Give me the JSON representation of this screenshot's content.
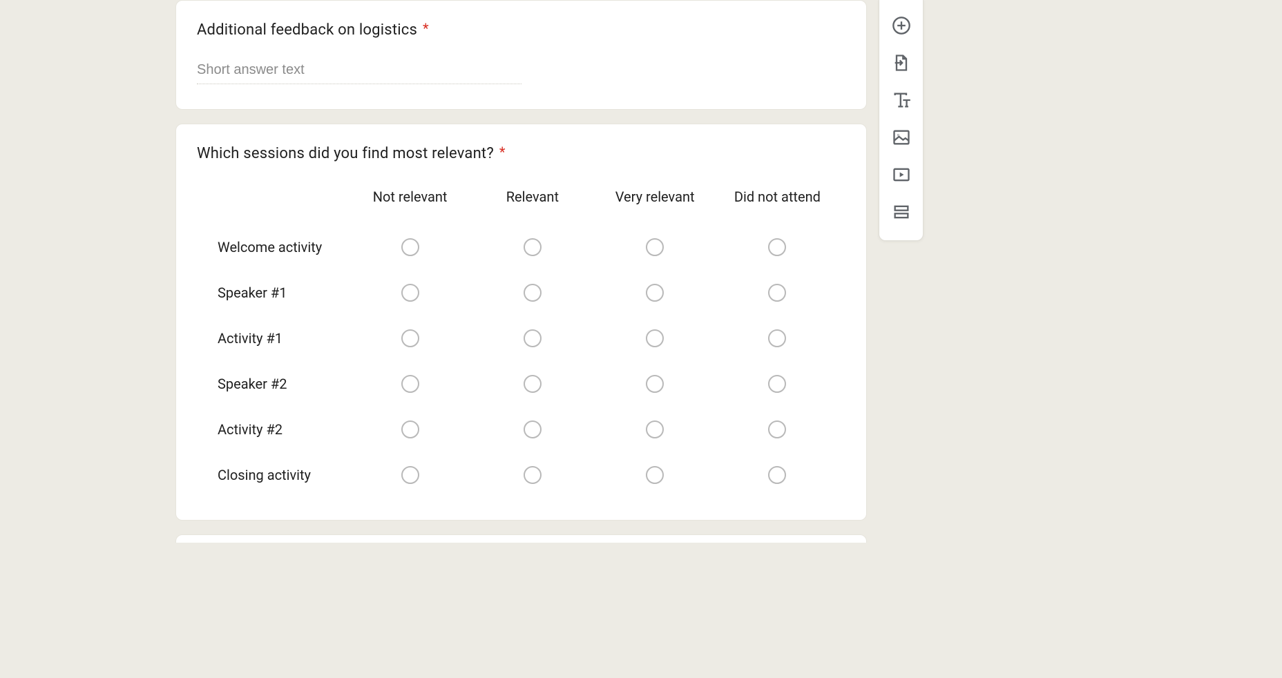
{
  "questions": {
    "feedback": {
      "title": "Additional feedback on logistics",
      "placeholder": "Short answer text"
    },
    "sessions": {
      "title": "Which sessions did you find most relevant?",
      "columns": [
        "Not relevant",
        "Relevant",
        "Very relevant",
        "Did not attend"
      ],
      "rows": [
        "Welcome activity",
        "Speaker #1",
        "Activity #1",
        "Speaker #2",
        "Activity #2",
        "Closing activity"
      ]
    }
  },
  "toolbar": {
    "addQuestion": "Add question",
    "importQuestions": "Import questions",
    "addTitle": "Add title and description",
    "addImage": "Add image",
    "addVideo": "Add video",
    "addSection": "Add section"
  },
  "required_indicator": "*"
}
